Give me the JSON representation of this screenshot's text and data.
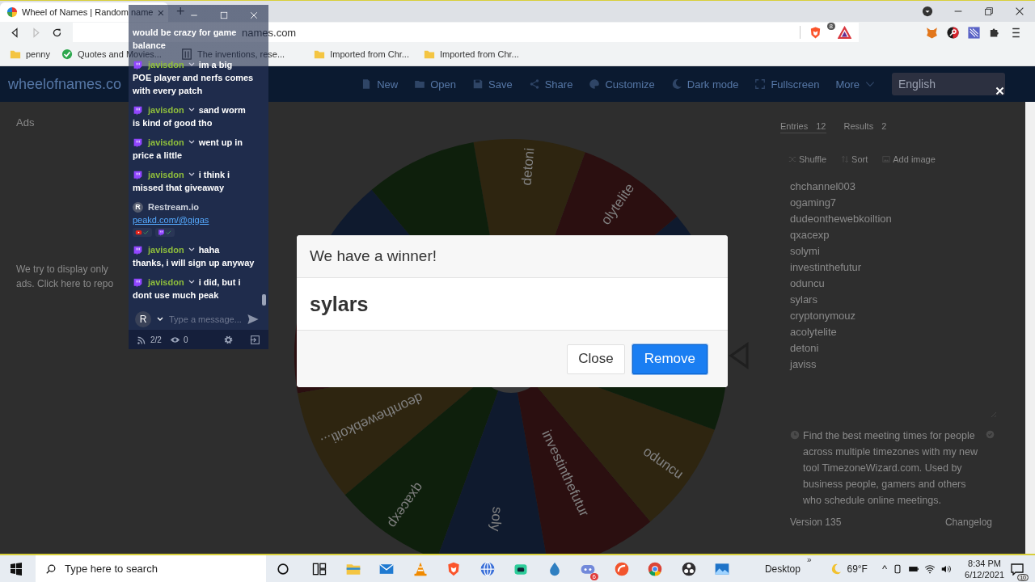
{
  "browser": {
    "tab_title": "Wheel of Names | Random name",
    "tab_close": "×",
    "new_tab": "+",
    "address": "names.com",
    "shield_badge": "8",
    "bookmarks": [
      {
        "label": "penny",
        "kind": "folder"
      },
      {
        "label": "Quotes and Movies...",
        "kind": "site"
      },
      {
        "label": "The inventions, rese...",
        "kind": "doc"
      },
      {
        "label": "Imported from Chr...",
        "kind": "folder"
      },
      {
        "label": "Imported from Chr...",
        "kind": "folder"
      }
    ]
  },
  "header": {
    "logo": "wheelofnames.co",
    "menu": [
      {
        "label": "New",
        "kind": "file"
      },
      {
        "label": "Open",
        "kind": "folder"
      },
      {
        "label": "Save",
        "kind": "save"
      },
      {
        "label": "Share",
        "kind": "share"
      },
      {
        "label": "Customize",
        "kind": "palette"
      },
      {
        "label": "Dark mode",
        "kind": "moon"
      },
      {
        "label": "Fullscreen",
        "kind": "expand"
      },
      {
        "label": "More",
        "kind": "dropdown"
      }
    ],
    "language": "English"
  },
  "ads": {
    "title": "Ads",
    "notice_lines": [
      "We try to display only",
      "ads. Click here to repo"
    ]
  },
  "wheel": {
    "slices": [
      {
        "color": "#0f1a2e"
      },
      {
        "color": "#2b0f10"
      },
      {
        "color": "#2e2510",
        "label": "deonthewebkoiti..."
      },
      {
        "color": "#0e1f0c",
        "label": "qxacexp"
      },
      {
        "color": "#0f1a2e",
        "label": "soly"
      },
      {
        "color": "#2b0f10",
        "label": "investinthefutur"
      },
      {
        "color": "#2e2510",
        "label": "oduncu"
      },
      {
        "color": "#0e1f0c"
      },
      {
        "color": "#0f1a2e"
      },
      {
        "color": "#2b0f10",
        "label": "olytelite"
      },
      {
        "color": "#2e2510",
        "label": "detoni"
      },
      {
        "color": "#0e1f0c"
      }
    ]
  },
  "sidebar": {
    "tabs": [
      {
        "label": "Entries",
        "count": "12",
        "selected": true
      },
      {
        "label": "Results",
        "count": "2",
        "selected": false
      }
    ],
    "tools": [
      {
        "label": "Shuffle",
        "kind": "shuffle"
      },
      {
        "label": "Sort",
        "kind": "sort"
      },
      {
        "label": "Add image",
        "kind": "image"
      }
    ],
    "entries": [
      "chchannel003",
      "ogaming7",
      "dudeonthewebkoiltion",
      "qxacexp",
      "solymi",
      "investinthefutur",
      "oduncu",
      "sylars",
      "cryptonymouz",
      "acolytelite",
      "detoni",
      "javiss"
    ],
    "promo": "Find the best meeting times for people across multiple timezones with my new tool TimezoneWizard.com. Used by business people, gamers and others who schedule online meetings.",
    "version": "Version 135",
    "changelog": "Changelog"
  },
  "chat": {
    "messages": [
      {
        "kind": "continued",
        "text": "would be crazy for game balance"
      },
      {
        "kind": "twitch",
        "user": "javisdon",
        "lines": [
          "im a big",
          "POE player and nerfs comes with every patch"
        ]
      },
      {
        "kind": "twitch",
        "user": "javisdon",
        "lines": [
          "sand worm",
          "is kind of good tho"
        ]
      },
      {
        "kind": "twitch",
        "user": "javisdon",
        "lines": [
          "went up in",
          "price a little"
        ]
      },
      {
        "kind": "twitch",
        "user": "javisdon",
        "lines": [
          "i think i",
          "missed that giveaway"
        ]
      },
      {
        "kind": "restream",
        "user": "Restream.io",
        "avatar": "R",
        "link": "peakd.com/@gigas",
        "platforms": [
          {
            "kind": "youtube"
          },
          {
            "kind": "twitch"
          }
        ]
      },
      {
        "kind": "twitch",
        "user": "javisdon",
        "lines": [
          "haha",
          "thanks, i will sign up anyway"
        ]
      },
      {
        "kind": "twitch",
        "user": "javisdon",
        "lines": [
          "i did, but i",
          "dont use much peak"
        ]
      }
    ],
    "avatar": "R",
    "placeholder": "Type a message...",
    "channels": "2/2",
    "viewers": "0"
  },
  "modal": {
    "title": "We have a winner!",
    "winner": "sylars",
    "buttons": [
      {
        "label": "Close",
        "kind": "secondary"
      },
      {
        "label": "Remove",
        "kind": "primary"
      }
    ]
  },
  "taskbar": {
    "search_placeholder": "Type here to search",
    "apps": [
      {
        "kind": "cortana"
      },
      {
        "kind": "taskview"
      },
      {
        "kind": "explorer"
      },
      {
        "kind": "mail"
      },
      {
        "kind": "vlc"
      },
      {
        "kind": "brave"
      },
      {
        "kind": "globe"
      },
      {
        "kind": "bot"
      },
      {
        "kind": "drop"
      },
      {
        "kind": "discord",
        "badge": "6"
      },
      {
        "kind": "rcircle"
      },
      {
        "kind": "chrome"
      },
      {
        "kind": "obs"
      },
      {
        "kind": "photos"
      }
    ],
    "desktop": "Desktop",
    "overflow": "»",
    "temperature": "69°F",
    "tray_toggle": "^",
    "tray": [
      {
        "kind": "device"
      },
      {
        "kind": "battery"
      },
      {
        "kind": "wifi"
      },
      {
        "kind": "speaker"
      }
    ],
    "time": "8:34 PM",
    "date": "6/12/2021",
    "notifications": "10"
  }
}
